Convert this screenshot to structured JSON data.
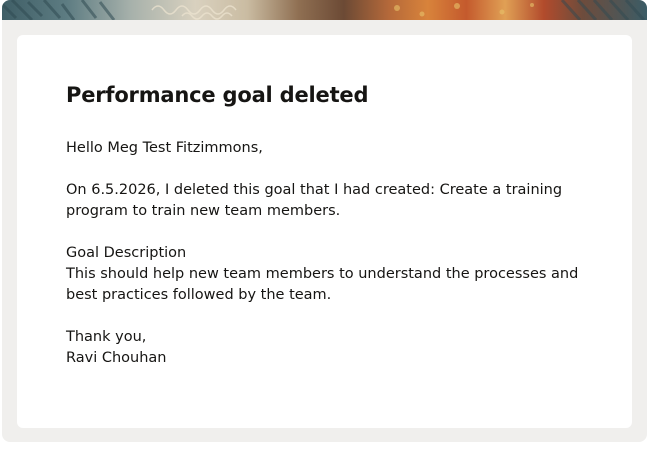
{
  "email": {
    "title": "Performance goal deleted",
    "greeting": "Hello Meg Test Fitzimmons,",
    "message": "On 6.5.2026, I deleted this goal that I had created: Create a training program to train new team members.",
    "goal_description_label": "Goal Description",
    "goal_description": "This should help new team members to understand the processes and best practices followed by the team.",
    "closing": "Thank you,",
    "sender": "Ravi Chouhan"
  },
  "colors": {
    "page_background": "#f0efed",
    "card_background": "#ffffff",
    "text": "#161513"
  }
}
